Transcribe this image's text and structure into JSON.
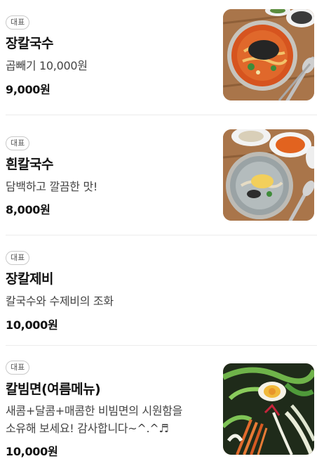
{
  "menu": [
    {
      "badge": "대표",
      "name": "장칼국수",
      "description": "곱빼기 10,000원",
      "price": "9,000원",
      "has_image": true,
      "image_icon": "spicy-noodle-soup-photo"
    },
    {
      "badge": "대표",
      "name": "흰칼국수",
      "description": "담백하고 깔끔한 맛!",
      "price": "8,000원",
      "has_image": true,
      "image_icon": "clear-noodle-soup-photo"
    },
    {
      "badge": "대표",
      "name": "장칼제비",
      "description": "칼국수와 수제비의 조화",
      "price": "10,000원",
      "has_image": false
    },
    {
      "badge": "대표",
      "name": "칼빔면(여름메뉴)",
      "description_lines": [
        "새콤+달콤+매콤한 비빔면의 시원함을",
        "소유해 보세요! 감사합니다~^.^♬"
      ],
      "price": "10,000원",
      "has_image": true,
      "image_icon": "bibim-noodle-photo"
    }
  ],
  "colors": {
    "text_primary": "#111111",
    "text_secondary": "#444444",
    "badge_border": "#c9c9c9",
    "divider": "#ececec"
  }
}
